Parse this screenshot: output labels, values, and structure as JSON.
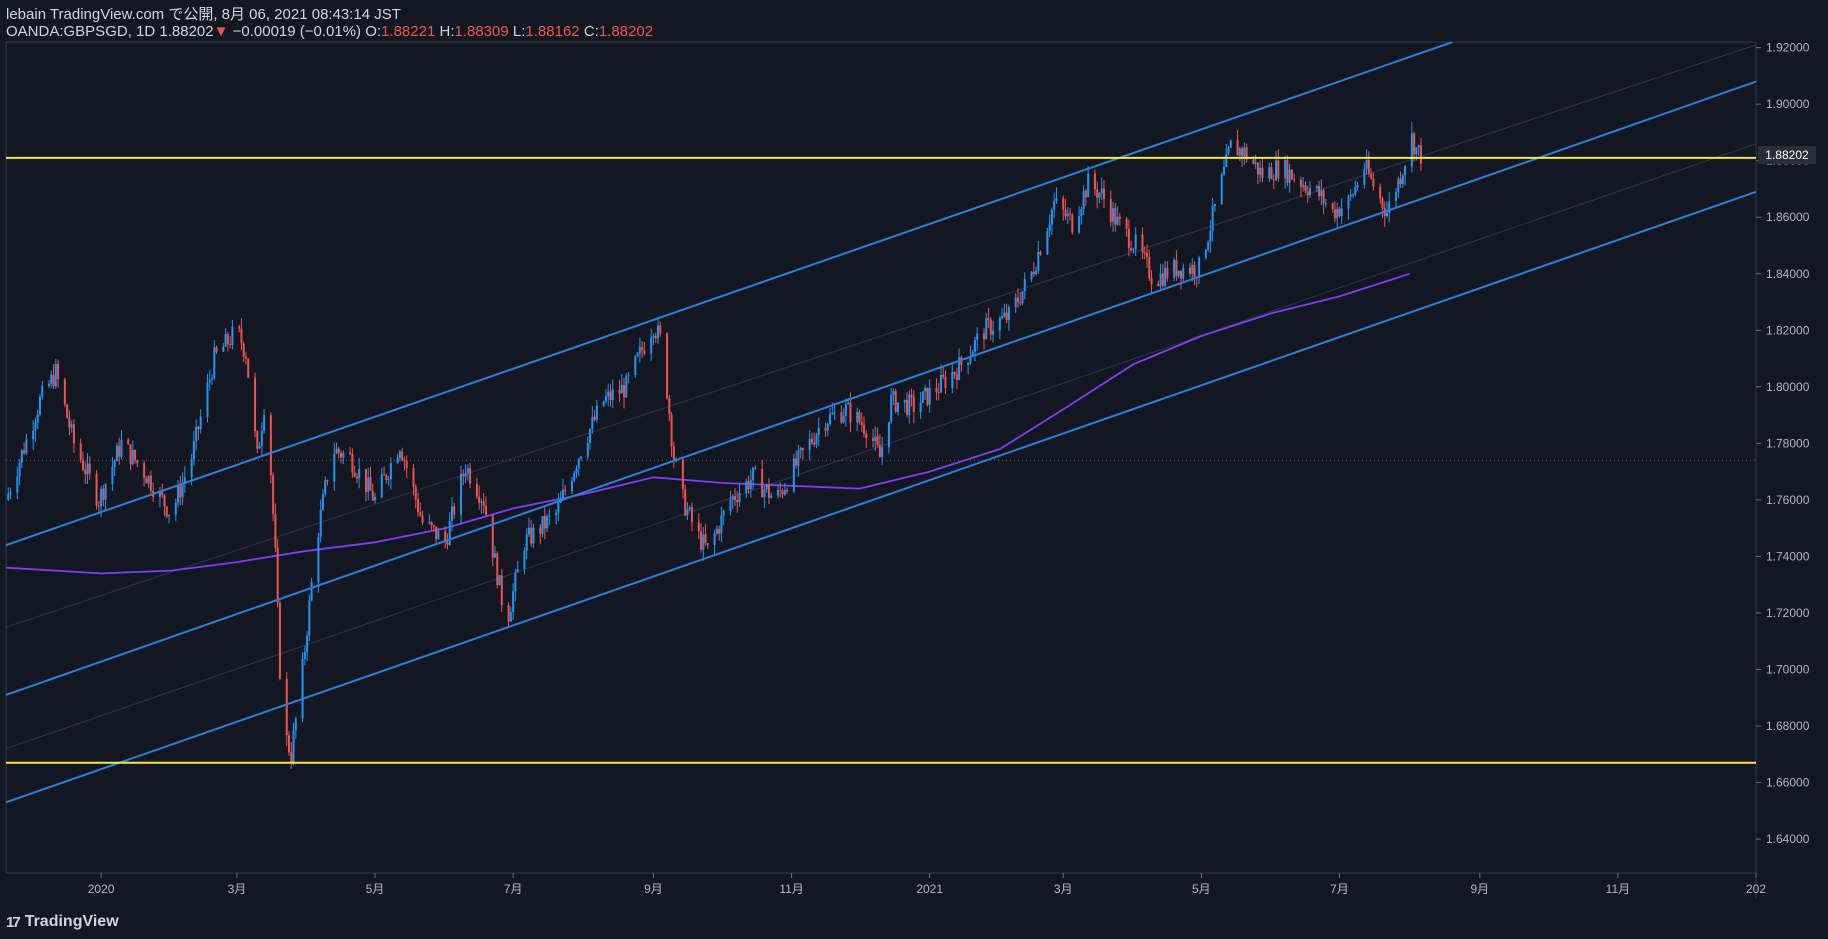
{
  "header": {
    "line1": "lebain TradingView.com で公開, 8月 06, 2021 08:43:14 JST",
    "symbol": "OANDA:GBPSGD, 1D 1.88202",
    "arrow": "▼",
    "change": "−0.00019 (−0.01%)",
    "o_label": "O:",
    "o_value": "1.88221",
    "h_label": "H:",
    "h_value": "1.88309",
    "l_label": "L:",
    "l_value": "1.88162",
    "c_label": "C:",
    "c_value": "1.88202"
  },
  "footer": {
    "brand": "TradingView",
    "logo_glyph": "17"
  },
  "colors": {
    "background": "#131722",
    "up": "#2196f3",
    "down": "#ef5350",
    "channel": "#2962ff",
    "level": "#f3e845",
    "ma": "#7e3ff2",
    "grid": "#1e2230"
  },
  "chart_data": {
    "type": "candlestick",
    "symbol": "OANDA:GBPSGD",
    "interval": "1D",
    "last_price": "1.88202",
    "ylim": [
      1.628,
      1.922
    ],
    "y_ticks": [
      "1.92000",
      "1.90000",
      "1.88000",
      "1.86000",
      "1.84000",
      "1.82000",
      "1.80000",
      "1.78000",
      "1.76000",
      "1.74000",
      "1.72000",
      "1.70000",
      "1.68000",
      "1.66000",
      "1.64000"
    ],
    "y_tick_values": [
      1.92,
      1.9,
      1.88,
      1.86,
      1.84,
      1.82,
      1.8,
      1.78,
      1.76,
      1.74,
      1.72,
      1.7,
      1.68,
      1.66,
      1.64
    ],
    "x_ticks": [
      "2020",
      "3月",
      "5月",
      "7月",
      "9月",
      "11月",
      "2021",
      "3月",
      "5月",
      "7月",
      "9月",
      "11月",
      "202"
    ],
    "x_tick_dates": [
      "2020-01-01",
      "2020-03-01",
      "2020-05-01",
      "2020-07-01",
      "2020-09-01",
      "2020-11-01",
      "2021-01-01",
      "2021-03-01",
      "2021-05-01",
      "2021-07-01",
      "2021-09-01",
      "2021-11-01",
      "2022-01-01"
    ],
    "x_range": [
      "2019-11-20",
      "2022-01-01"
    ],
    "price_path": [
      [
        "2019-11-20",
        1.76
      ],
      [
        "2019-12-05",
        1.795
      ],
      [
        "2019-12-12",
        1.805
      ],
      [
        "2019-12-20",
        1.78
      ],
      [
        "2019-12-31",
        1.76
      ],
      [
        "2020-01-10",
        1.78
      ],
      [
        "2020-01-20",
        1.77
      ],
      [
        "2020-02-01",
        1.755
      ],
      [
        "2020-02-10",
        1.775
      ],
      [
        "2020-02-20",
        1.81
      ],
      [
        "2020-03-01",
        1.82
      ],
      [
        "2020-03-05",
        1.812
      ],
      [
        "2020-03-10",
        1.775
      ],
      [
        "2020-03-14",
        1.8
      ],
      [
        "2020-03-18",
        1.74
      ],
      [
        "2020-03-21",
        1.68
      ],
      [
        "2020-03-25",
        1.67
      ],
      [
        "2020-03-30",
        1.7
      ],
      [
        "2020-04-05",
        1.745
      ],
      [
        "2020-04-12",
        1.778
      ],
      [
        "2020-04-20",
        1.775
      ],
      [
        "2020-05-01",
        1.76
      ],
      [
        "2020-05-12",
        1.78
      ],
      [
        "2020-05-22",
        1.752
      ],
      [
        "2020-06-01",
        1.745
      ],
      [
        "2020-06-10",
        1.772
      ],
      [
        "2020-06-18",
        1.76
      ],
      [
        "2020-06-26",
        1.725
      ],
      [
        "2020-06-29",
        1.72
      ],
      [
        "2020-07-06",
        1.745
      ],
      [
        "2020-07-20",
        1.755
      ],
      [
        "2020-08-01",
        1.78
      ],
      [
        "2020-08-10",
        1.795
      ],
      [
        "2020-08-20",
        1.8
      ],
      [
        "2020-08-28",
        1.815
      ],
      [
        "2020-09-01",
        1.822
      ],
      [
        "2020-09-05",
        1.815
      ],
      [
        "2020-09-10",
        1.775
      ],
      [
        "2020-09-14",
        1.76
      ],
      [
        "2020-09-20",
        1.748
      ],
      [
        "2020-09-25",
        1.742
      ],
      [
        "2020-10-05",
        1.76
      ],
      [
        "2020-10-15",
        1.768
      ],
      [
        "2020-10-25",
        1.76
      ],
      [
        "2020-11-05",
        1.775
      ],
      [
        "2020-11-15",
        1.788
      ],
      [
        "2020-11-25",
        1.792
      ],
      [
        "2020-12-05",
        1.785
      ],
      [
        "2020-12-10",
        1.775
      ],
      [
        "2020-12-15",
        1.795
      ],
      [
        "2020-12-25",
        1.793
      ],
      [
        "2021-01-05",
        1.8
      ],
      [
        "2021-01-15",
        1.808
      ],
      [
        "2021-01-25",
        1.82
      ],
      [
        "2021-02-05",
        1.825
      ],
      [
        "2021-02-15",
        1.84
      ],
      [
        "2021-02-25",
        1.865
      ],
      [
        "2021-03-05",
        1.858
      ],
      [
        "2021-03-12",
        1.872
      ],
      [
        "2021-03-18",
        1.868
      ],
      [
        "2021-03-25",
        1.858
      ],
      [
        "2021-04-02",
        1.85
      ],
      [
        "2021-04-10",
        1.838
      ],
      [
        "2021-04-20",
        1.842
      ],
      [
        "2021-04-30",
        1.842
      ],
      [
        "2021-05-06",
        1.86
      ],
      [
        "2021-05-14",
        1.885
      ],
      [
        "2021-05-20",
        1.883
      ],
      [
        "2021-05-28",
        1.875
      ],
      [
        "2021-06-05",
        1.878
      ],
      [
        "2021-06-15",
        1.872
      ],
      [
        "2021-06-22",
        1.868
      ],
      [
        "2021-06-28",
        1.862
      ],
      [
        "2021-07-05",
        1.865
      ],
      [
        "2021-07-12",
        1.878
      ],
      [
        "2021-07-18",
        1.868
      ],
      [
        "2021-07-22",
        1.862
      ],
      [
        "2021-07-28",
        1.875
      ],
      [
        "2021-08-02",
        1.888
      ],
      [
        "2021-08-04",
        1.884
      ],
      [
        "2021-08-06",
        1.882
      ]
    ],
    "moving_average": [
      [
        "2019-11-20",
        1.736
      ],
      [
        "2020-01-01",
        1.734
      ],
      [
        "2020-02-01",
        1.735
      ],
      [
        "2020-03-01",
        1.738
      ],
      [
        "2020-04-01",
        1.742
      ],
      [
        "2020-05-01",
        1.745
      ],
      [
        "2020-06-01",
        1.75
      ],
      [
        "2020-07-01",
        1.757
      ],
      [
        "2020-08-01",
        1.762
      ],
      [
        "2020-09-01",
        1.768
      ],
      [
        "2020-10-01",
        1.766
      ],
      [
        "2020-11-01",
        1.765
      ],
      [
        "2020-12-01",
        1.764
      ],
      [
        "2021-01-01",
        1.77
      ],
      [
        "2021-02-01",
        1.778
      ],
      [
        "2021-03-01",
        1.792
      ],
      [
        "2021-04-01",
        1.808
      ],
      [
        "2021-05-01",
        1.818
      ],
      [
        "2021-06-01",
        1.826
      ],
      [
        "2021-07-01",
        1.832
      ],
      [
        "2021-08-01",
        1.84
      ]
    ],
    "horizontal_levels": [
      1.881,
      1.667
    ],
    "channel_lines": [
      {
        "start": [
          "2019-11-20",
          1.744
        ],
        "end": [
          "2021-08-20",
          1.922
        ]
      },
      {
        "start": [
          "2019-11-20",
          1.691
        ],
        "end": [
          "2022-01-01",
          1.908
        ]
      },
      {
        "start": [
          "2019-11-20",
          1.653
        ],
        "end": [
          "2022-01-01",
          1.869
        ]
      }
    ],
    "faint_lines": [
      {
        "start": [
          "2019-11-20",
          1.715
        ],
        "end": [
          "2022-01-01",
          1.921
        ]
      },
      {
        "start": [
          "2019-11-20",
          1.672
        ],
        "end": [
          "2022-01-01",
          1.886
        ]
      }
    ],
    "dotted_level": 1.774,
    "grid": false,
    "legend": "none"
  }
}
